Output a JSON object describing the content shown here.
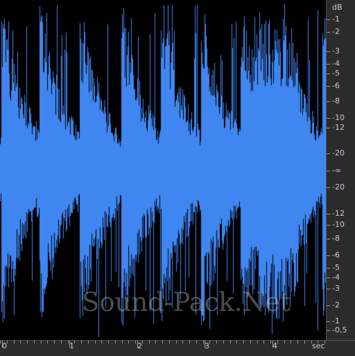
{
  "colors": {
    "waveform": "#3f86f0",
    "background": "#000000",
    "ruler_bg": "#2b2b2b",
    "ruler_text": "#cfcfcf"
  },
  "db_ruler": {
    "unit": "dB",
    "labels": [
      "-1",
      "-2",
      "-3",
      "-4",
      "-5",
      "-6",
      "-8",
      "-10",
      "-12",
      "-20",
      "-∞",
      "-20",
      "-12",
      "-10",
      "-8",
      "-6",
      "-5",
      "-4",
      "-3",
      "-2",
      "-1",
      "-0,5"
    ]
  },
  "time_ruler": {
    "labels": [
      "0",
      "1",
      "2",
      "3",
      "4"
    ],
    "unit": "sec"
  },
  "watermark": "Sound-Pack.Net"
}
